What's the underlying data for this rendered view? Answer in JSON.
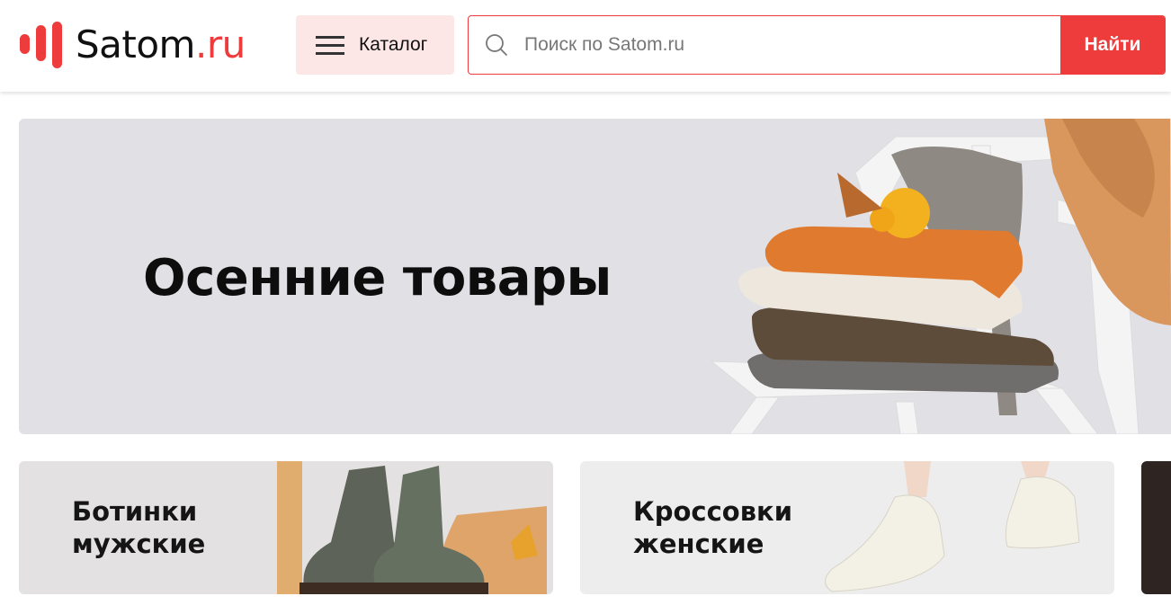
{
  "header": {
    "logo": {
      "name": "Satom",
      "suffix": ".ru"
    },
    "catalog_label": "Каталог",
    "search": {
      "placeholder": "Поиск по Satom.ru",
      "value": "",
      "button_label": "Найти"
    }
  },
  "hero": {
    "title": "Осенние товары"
  },
  "cards": [
    {
      "line1": "Ботинки",
      "line2": "мужские"
    },
    {
      "line1": "Кроссовки",
      "line2": "женские"
    }
  ],
  "colors": {
    "accent": "#ee3b3b",
    "catalog_bg": "#fde6e6",
    "hero_bg": "#e1e0e5"
  },
  "icons": [
    "logo-bars-icon",
    "menu-icon",
    "search-icon"
  ]
}
